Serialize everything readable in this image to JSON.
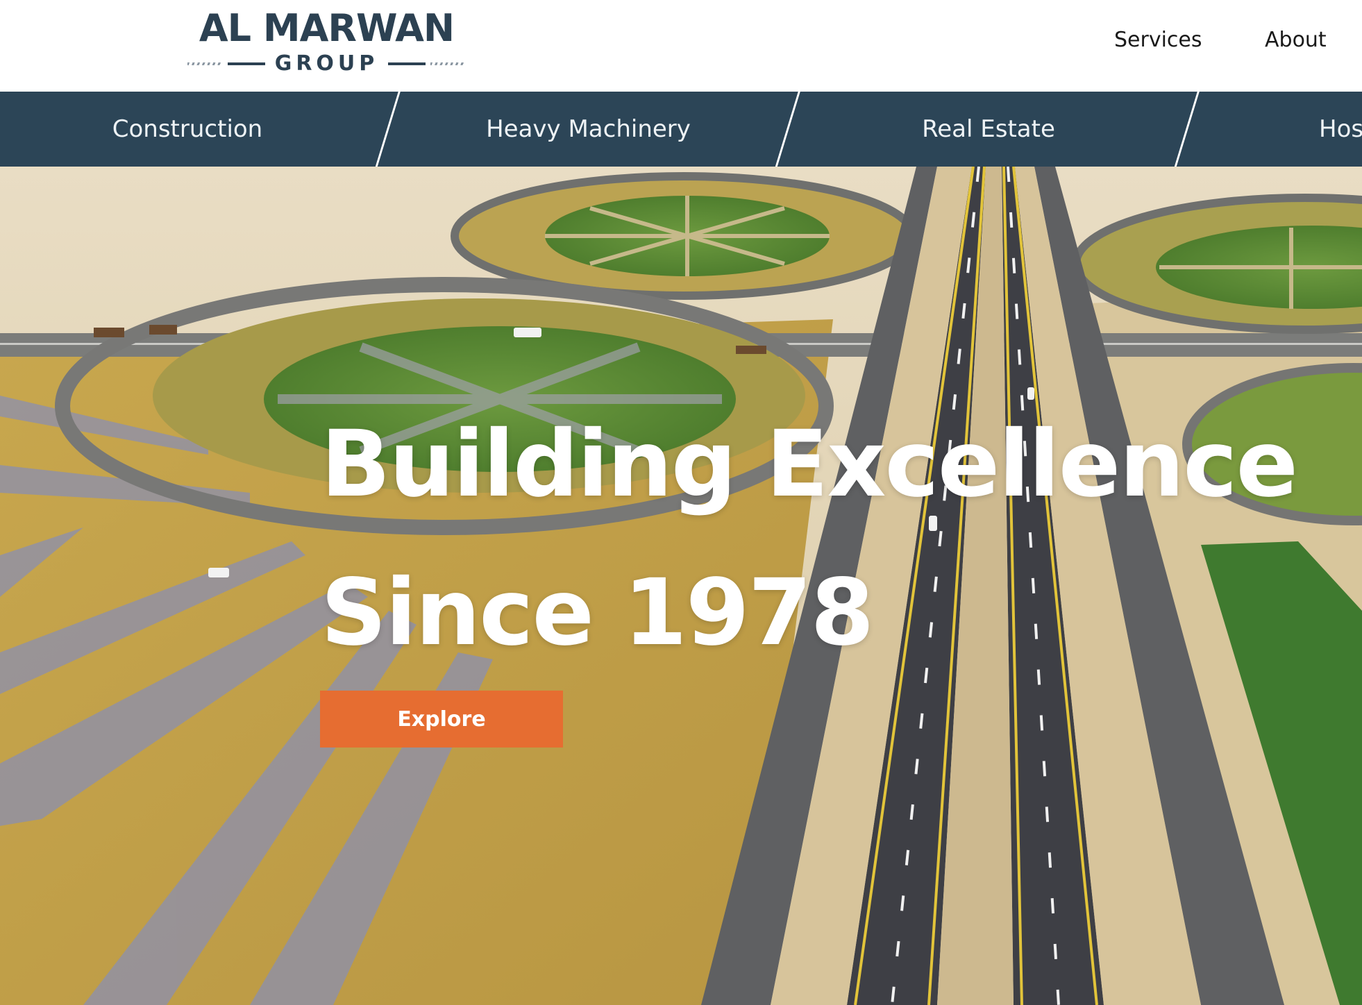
{
  "logo": {
    "main": "AL MARWAN",
    "sub": "GROUP"
  },
  "top_nav": {
    "services": "Services",
    "about": "About"
  },
  "categories": [
    "Construction",
    "Heavy Machinery",
    "Real Estate",
    "Hos"
  ],
  "hero": {
    "headline_line1": "Building Excellence",
    "headline_line2": "Since 1978",
    "cta_label": "Explore"
  },
  "colors": {
    "brand_navy": "#2c4152",
    "category_bar": "#2c4557",
    "cta_orange": "#e66d31"
  }
}
